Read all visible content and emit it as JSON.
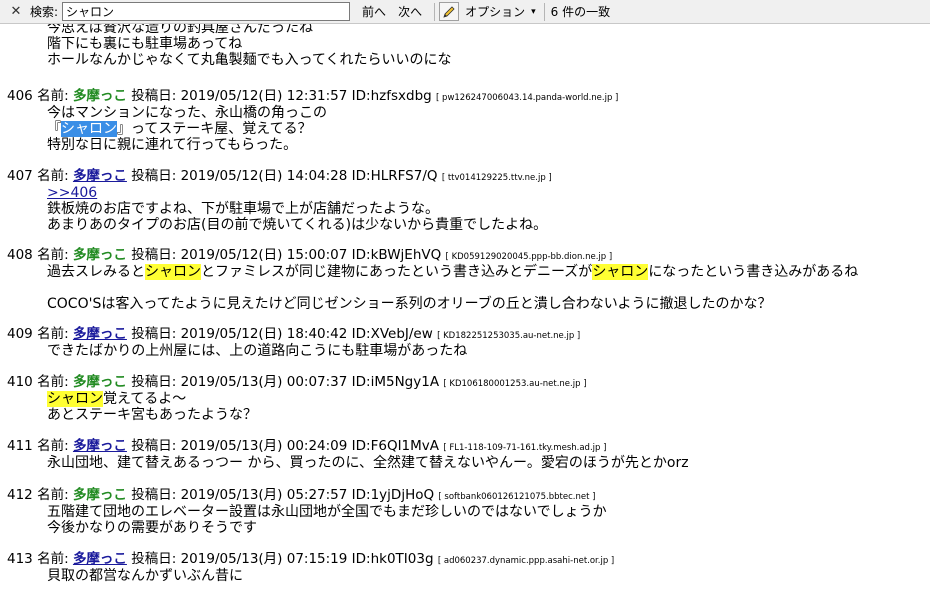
{
  "findbar": {
    "close_icon": "close-icon",
    "label": "検索:",
    "query": "シャロン",
    "prev_label": "前へ",
    "next_label": "次へ",
    "highlight_icon": "highlighter-pen-icon",
    "options_label": "オプション",
    "options_arrow": "▾",
    "match_count": "6 件の一致"
  },
  "colors": {
    "name_green": "#228b22",
    "link_blue": "#1a1a9c",
    "match_highlight": "#ffff33",
    "current_match": "#3a8ee6"
  },
  "top_fragment": [
    "今思えば贅沢な造りの釣具屋さんだったね",
    "階下にも裏にも駐車場あってね",
    "ホールなんかじゃなくて丸亀製麺でも入ってくれたらいいのにな"
  ],
  "posts": [
    {
      "num": "406",
      "name_label": "名前:",
      "name": "多摩っこ",
      "date_label": "投稿日:",
      "datetime": "2019/05/12(日) 12:31:57",
      "id": "ID:hzfsxdbg",
      "ip": "[ pw126247006043.14.panda-world.ne.jp ]",
      "lines": [
        {
          "pre": "今はマンションになった、永山橋の角っこの",
          "hl": "",
          "post": ""
        },
        {
          "pre": "『",
          "hl": "シャロン",
          "post": "』ってステーキ屋、覚えてる？"
        },
        {
          "pre": "特別な日に親に連れて行ってもらった。",
          "hl": "",
          "post": ""
        }
      ]
    },
    {
      "num": "407",
      "name_label": "名前:",
      "name": "多摩っこ",
      "date_label": "投稿日:",
      "datetime": "2019/05/12(日) 14:04:28",
      "id": "ID:HLRFS7/Q",
      "ip": "[ ttv014129225.ttv.ne.jp ]",
      "anchor": ">>406",
      "lines": [
        {
          "text": "鉄板焼のお店ですよね、下が駐車場で上が店舗だったような。"
        },
        {
          "text": "あまりあのタイプのお店(目の前で焼いてくれる)は少ないから貴重でしたよね。"
        }
      ]
    },
    {
      "num": "408",
      "name_label": "名前:",
      "name": "多摩っこ",
      "date_label": "投稿日:",
      "datetime": "2019/05/12(日) 15:00:07",
      "id": "ID:kBWjEhVQ",
      "ip": "[ KD059129020045.ppp-bb.dion.ne.jp ]",
      "line1": {
        "a": "過去スレみると",
        "h1": "シャロン",
        "b": "とファミレスが同じ建物にあったという書き込みとデニーズが",
        "h2": "シャロン",
        "c": "になったという書き込みがあるね"
      },
      "line2": "COCO'Sは客入ってたように見えたけど同じゼンショー系列のオリーブの丘と潰し合わないように撤退したのかな？"
    },
    {
      "num": "409",
      "name_label": "名前:",
      "name": "多摩っこ",
      "date_label": "投稿日:",
      "datetime": "2019/05/12(日) 18:40:42",
      "id": "ID:XVebJ/ew",
      "ip": "[ KD182251253035.au-net.ne.jp ]",
      "lines": [
        {
          "text": "できたばかりの上州屋には、上の道路向こうにも駐車場があったね"
        }
      ]
    },
    {
      "num": "410",
      "name_label": "名前:",
      "name": "多摩っこ",
      "date_label": "投稿日:",
      "datetime": "2019/05/13(月) 00:07:37",
      "id": "ID:iM5Ngy1A",
      "ip": "[ KD106180001253.au-net.ne.jp ]",
      "line1": {
        "hl": "シャロン",
        "post": "覚えてるよ～"
      },
      "line2": "あとステーキ宮もあったような？"
    },
    {
      "num": "411",
      "name_label": "名前:",
      "name": "多摩っこ",
      "date_label": "投稿日:",
      "datetime": "2019/05/13(月) 00:24:09",
      "id": "ID:F6QI1MvA",
      "ip": "[ FL1-118-109-71-161.tky.mesh.ad.jp ]",
      "lines": [
        {
          "text": "永山団地、建て替えあるっつー から、買ったのに、全然建て替えないやんー。愛宕のほうが先とかorz"
        }
      ]
    },
    {
      "num": "412",
      "name_label": "名前:",
      "name": "多摩っこ",
      "date_label": "投稿日:",
      "datetime": "2019/05/13(月) 05:27:57",
      "id": "ID:1yjDjHoQ",
      "ip": "[ softbank060126121075.bbtec.net ]",
      "lines": [
        {
          "text": "五階建て団地のエレベーター設置は永山団地が全国でもまだ珍しいのではないでしょうか"
        },
        {
          "text": "今後かなりの需要がありそうです"
        }
      ]
    },
    {
      "num": "413",
      "name_label": "名前:",
      "name": "多摩っこ",
      "date_label": "投稿日:",
      "datetime": "2019/05/13(月) 07:15:19",
      "id": "ID:hk0TI03g",
      "ip": "[ ad060237.dynamic.ppp.asahi-net.or.jp ]",
      "lines": [
        {
          "text": "貝取の都営なんかずいぶん昔に"
        }
      ]
    }
  ]
}
